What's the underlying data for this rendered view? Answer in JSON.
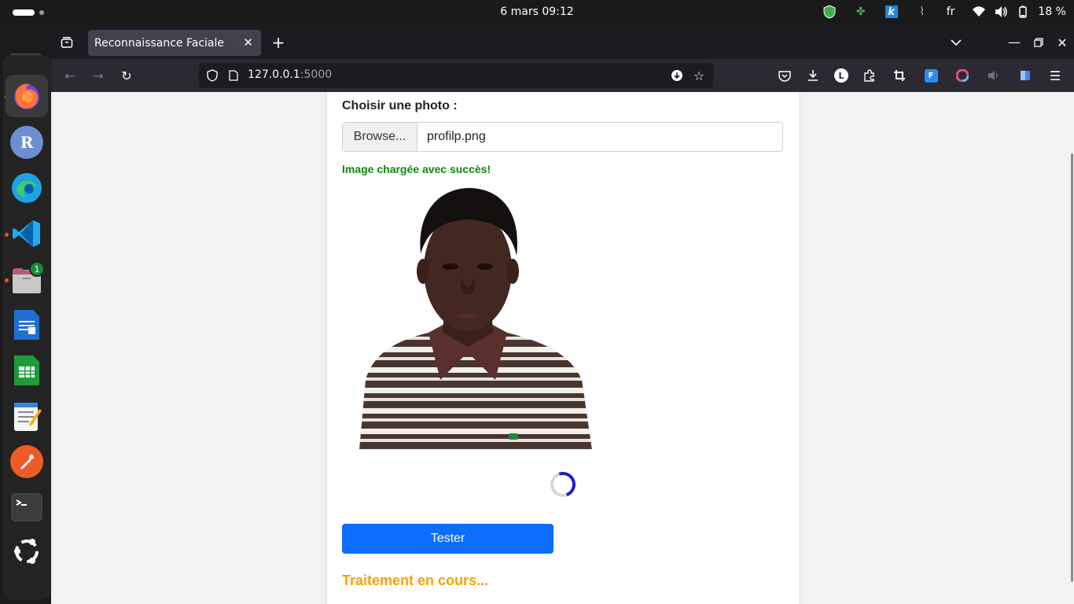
{
  "system": {
    "clock": "6 mars  09:12",
    "language": "fr",
    "battery": "18 %"
  },
  "dock": {
    "apps": [
      "firefox-icon",
      "r-icon",
      "edge-icon",
      "vscode-icon",
      "files-icon",
      "writer-icon",
      "calc-icon",
      "text-editor-icon",
      "postman-icon",
      "terminal-icon",
      "ubuntu-icon"
    ],
    "files_badge": "1",
    "r_letter": "R"
  },
  "browser": {
    "tab_title": "Reconnaissance Faciale",
    "url_host": "127.0.0.1",
    "url_port": ":5000",
    "toolbar_letter": "L"
  },
  "page": {
    "choose_label": "Choisir une photo :",
    "browse_label": "Browse...",
    "filename": "profilp.png",
    "success_message": "Image chargée avec succès!",
    "button_label": "Tester",
    "status_text": "Traitement en cours...",
    "accent_color": "#0d6efd",
    "success_color": "#118511",
    "status_color": "#f5a20a"
  }
}
